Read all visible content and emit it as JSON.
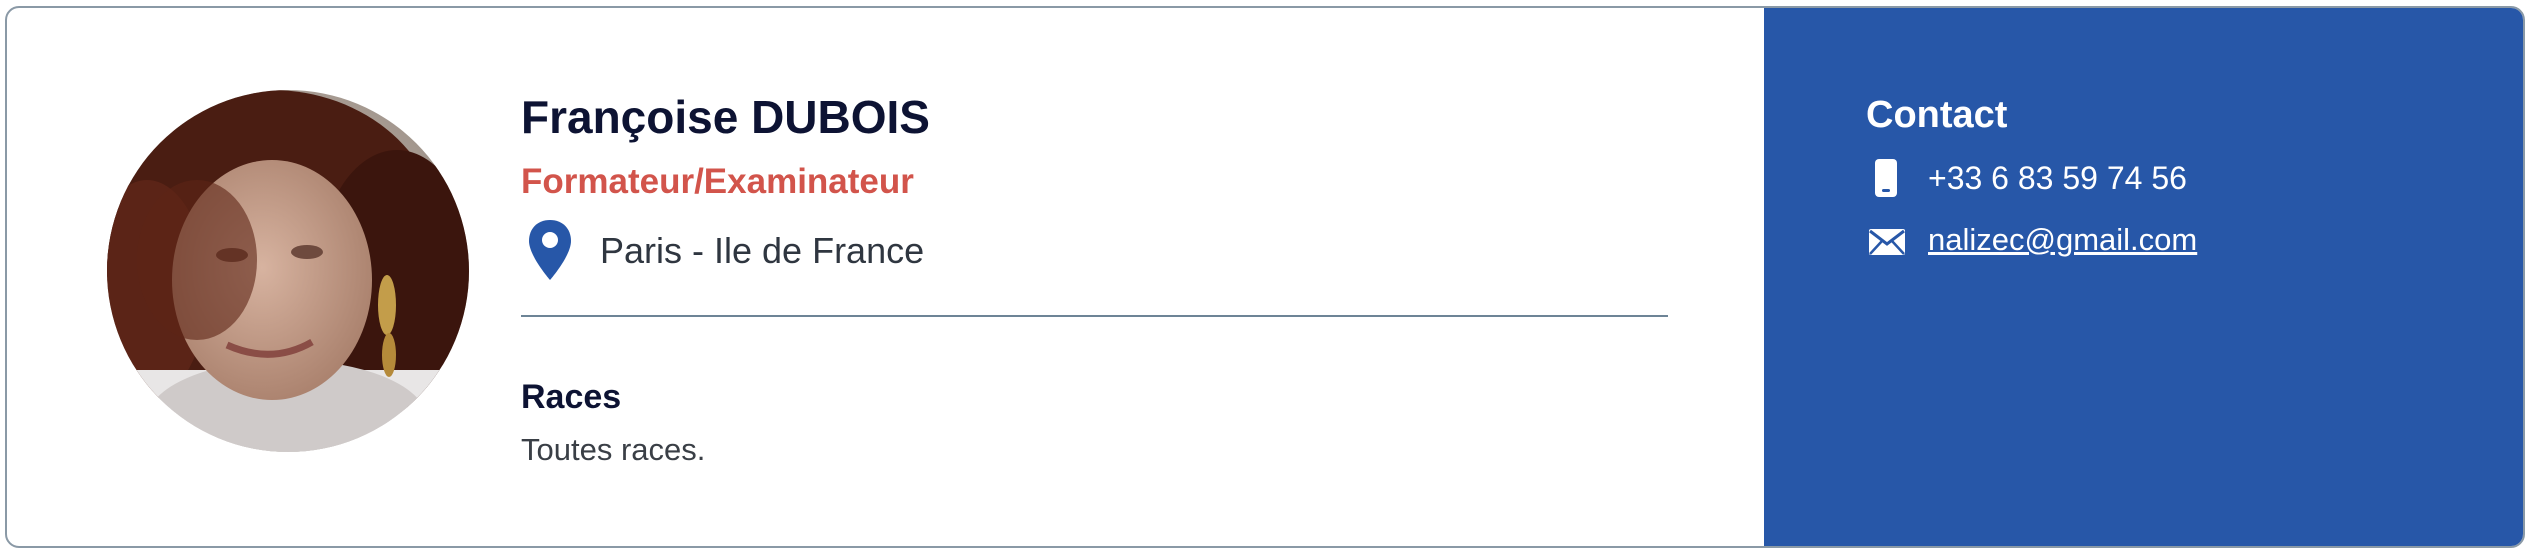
{
  "profile": {
    "name": "Françoise DUBOIS",
    "role": "Formateur/Examinateur",
    "location": "Paris - Ile de France",
    "races_title": "Races",
    "races_text": "Toutes races.",
    "avatar_icon": "person-photo"
  },
  "contact": {
    "title": "Contact",
    "phone": "+33 6 83 59 74 56",
    "email": "nalizec@gmail.com",
    "phone_icon": "phone-icon",
    "mail_icon": "mail-icon"
  },
  "colors": {
    "accent_blue": "#2757a8",
    "role_red": "#d2544b",
    "title_dark": "#0d1333",
    "border": "#8a99a6"
  }
}
